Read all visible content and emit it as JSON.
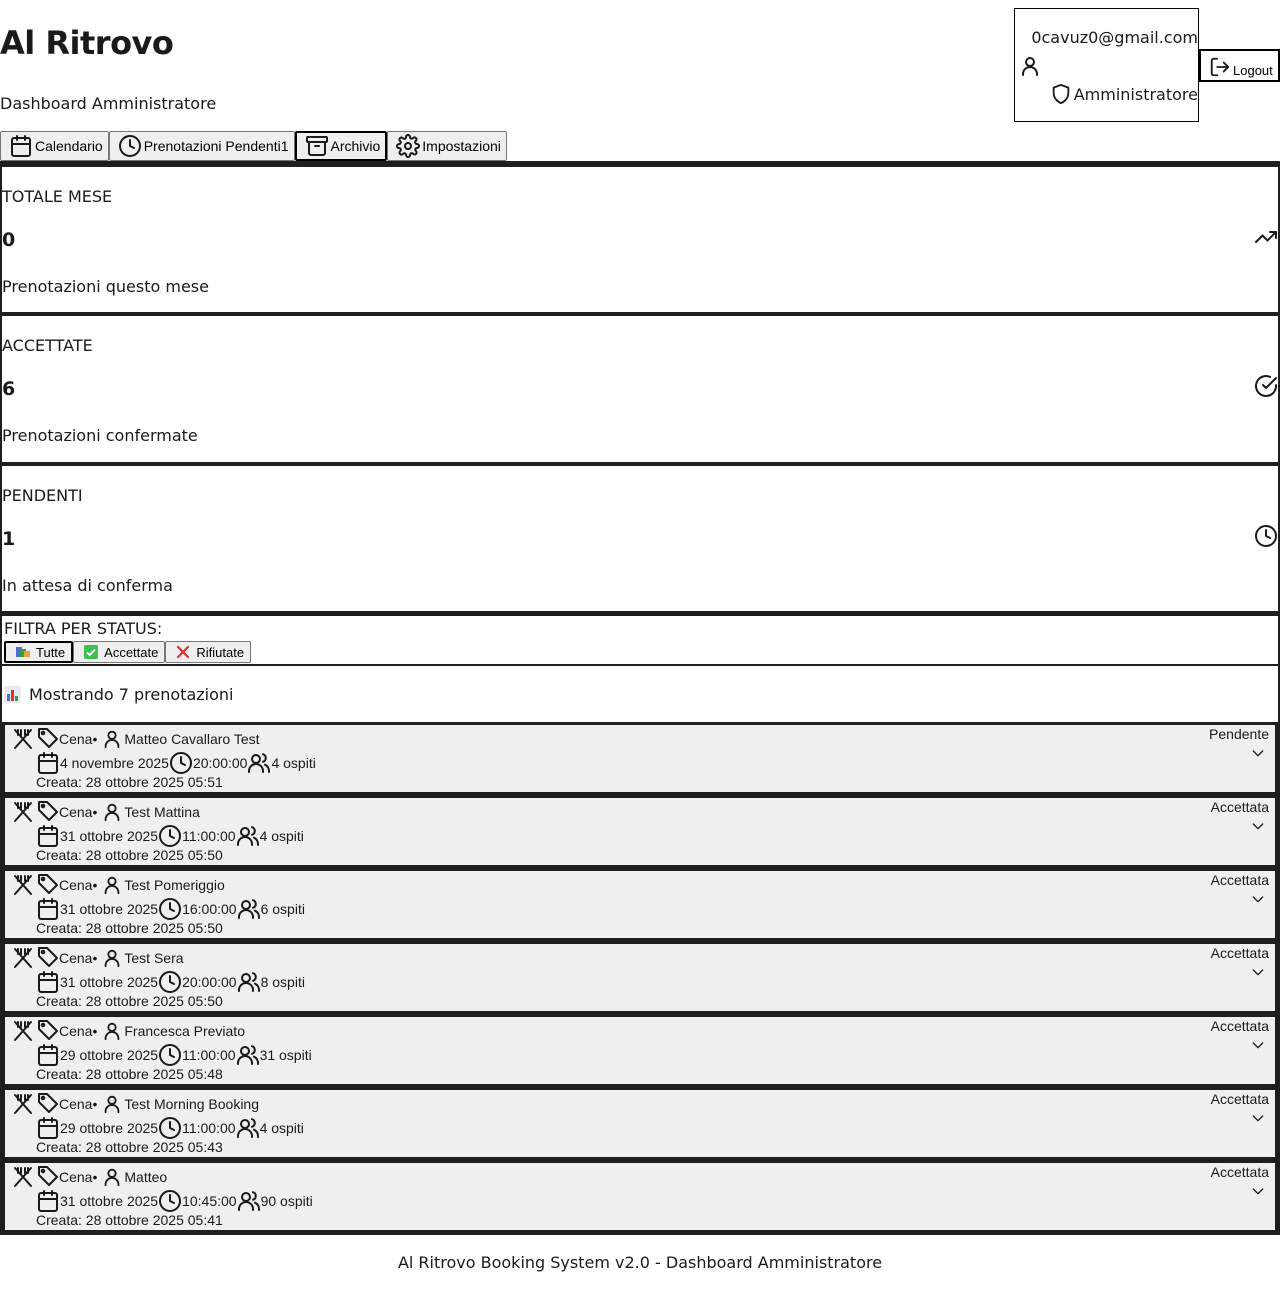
{
  "header": {
    "title": "Al Ritrovo",
    "subtitle": "Dashboard Amministratore"
  },
  "user": {
    "email": "0cavuz0@gmail.com",
    "role": "Amministratore",
    "logout_label": "Logout"
  },
  "tabs": [
    {
      "label": "Calendario",
      "icon": "calendar-icon",
      "active": false
    },
    {
      "label": "Prenotazioni Pendenti1",
      "icon": "clock-icon",
      "active": false
    },
    {
      "label": "Archivio",
      "icon": "archive-icon",
      "active": true
    },
    {
      "label": "Impostazioni",
      "icon": "gear-icon",
      "active": false
    }
  ],
  "stats": [
    {
      "label": "TOTALE MESE",
      "value": "0",
      "desc": "Prenotazioni questo mese",
      "icon": "trending-up-icon"
    },
    {
      "label": "ACCETTATE",
      "value": "6",
      "desc": "Prenotazioni confermate",
      "icon": "check-circle-icon"
    },
    {
      "label": "PENDENTI",
      "value": "1",
      "desc": "In attesa di conferma",
      "icon": "clock-icon"
    }
  ],
  "filter": {
    "label": "FILTRA PER STATUS:",
    "buttons": [
      {
        "label": "Tutte",
        "icon": "books-icon",
        "active": true
      },
      {
        "label": "Accettate",
        "icon": "check-box-icon",
        "active": false
      },
      {
        "label": "Rifiutate",
        "icon": "cross-mark-icon",
        "active": false
      }
    ]
  },
  "count_text": "Mostrando 7 prenotazioni",
  "bookings": [
    {
      "type": "Cena",
      "sep": "•",
      "name": "Matteo Cavallaro Test",
      "date": "4 novembre 2025",
      "time": "20:00:00",
      "guests": "4 ospiti",
      "created": "Creata: 28 ottobre 2025 05:51",
      "status": "Pendente"
    },
    {
      "type": "Cena",
      "sep": "•",
      "name": "Test Mattina",
      "date": "31 ottobre 2025",
      "time": "11:00:00",
      "guests": "4 ospiti",
      "created": "Creata: 28 ottobre 2025 05:50",
      "status": "Accettata"
    },
    {
      "type": "Cena",
      "sep": "•",
      "name": "Test Pomeriggio",
      "date": "31 ottobre 2025",
      "time": "16:00:00",
      "guests": "6 ospiti",
      "created": "Creata: 28 ottobre 2025 05:50",
      "status": "Accettata"
    },
    {
      "type": "Cena",
      "sep": "•",
      "name": "Test Sera",
      "date": "31 ottobre 2025",
      "time": "20:00:00",
      "guests": "8 ospiti",
      "created": "Creata: 28 ottobre 2025 05:50",
      "status": "Accettata"
    },
    {
      "type": "Cena",
      "sep": "•",
      "name": "Francesca Previato",
      "date": "29 ottobre 2025",
      "time": "11:00:00",
      "guests": "31 ospiti",
      "created": "Creata: 28 ottobre 2025 05:48",
      "status": "Accettata"
    },
    {
      "type": "Cena",
      "sep": "•",
      "name": "Test Morning Booking",
      "date": "29 ottobre 2025",
      "time": "11:00:00",
      "guests": "4 ospiti",
      "created": "Creata: 28 ottobre 2025 05:43",
      "status": "Accettata"
    },
    {
      "type": "Cena",
      "sep": "•",
      "name": "Matteo",
      "date": "31 ottobre 2025",
      "time": "10:45:00",
      "guests": "90 ospiti",
      "created": "Creata: 28 ottobre 2025 05:41",
      "status": "Accettata"
    }
  ],
  "footer": "Al Ritrovo Booking System v2.0 - Dashboard Amministratore"
}
